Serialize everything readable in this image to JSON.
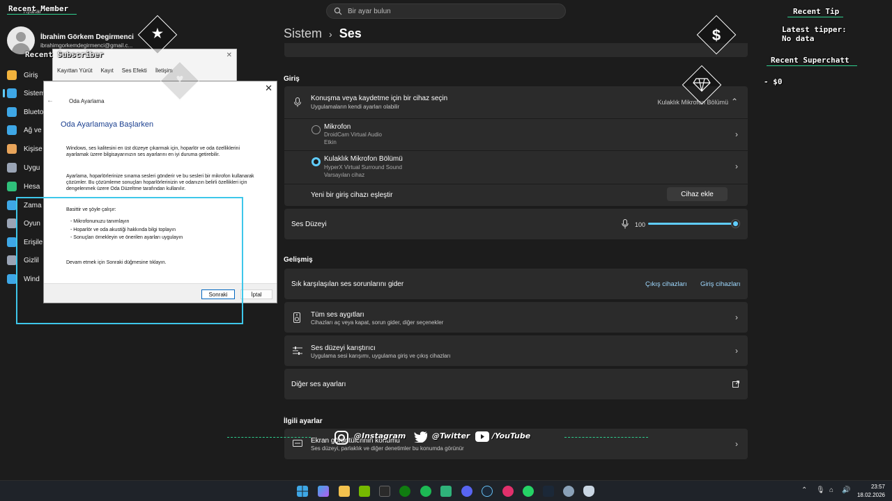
{
  "search": {
    "placeholder": "Bir ayar bulun"
  },
  "window": {
    "title": "Ayarlar"
  },
  "user": {
    "name": "İbrahim Görkem Degirmenci",
    "email": "ibrahimgorkemdegirmenci@gmail.c..."
  },
  "sidebar": {
    "items": [
      {
        "label": "Giriş",
        "color": "#f2b33d"
      },
      {
        "label": "Sistem",
        "color": "#3ea7e6"
      },
      {
        "label": "Bluetooth",
        "color": "#3ea7e6"
      },
      {
        "label": "Ağ ve",
        "color": "#3ea7e6"
      },
      {
        "label": "Kişise",
        "color": "#e8a45a"
      },
      {
        "label": "Uygu",
        "color": "#9aa4b5"
      },
      {
        "label": "Hesa",
        "color": "#2fbf7a"
      },
      {
        "label": "Zama",
        "color": "#3ea7e6"
      },
      {
        "label": "Oyun",
        "color": "#9aa4b5"
      },
      {
        "label": "Erişile",
        "color": "#3ea7e6"
      },
      {
        "label": "Gizlil",
        "color": "#9aa4b5"
      },
      {
        "label": "Wind",
        "color": "#3ea7e6"
      }
    ]
  },
  "breadcrumb": {
    "parent": "Sistem",
    "current": "Ses"
  },
  "input_section": {
    "label": "Giriş",
    "choose_title": "Konuşma veya kaydetme için bir cihaz seçin",
    "choose_sub": "Uygulamaların kendi ayarları olabilir",
    "choose_value": "Kulaklık Mikrofon Bölümü",
    "devices": [
      {
        "name": "Mikrofon",
        "line1": "DroidCam Virtual Audio",
        "line2": "Etkin",
        "selected": false
      },
      {
        "name": "Kulaklık Mikrofon Bölümü",
        "line1": "HyperX Virtual Surround Sound",
        "line2": "Varsayılan cihaz",
        "selected": true
      }
    ],
    "pair_label": "Yeni bir giriş cihazı eşleştir",
    "pair_button": "Cihaz ekle",
    "volume_label": "Ses Düzeyi",
    "volume_value": "100"
  },
  "advanced": {
    "label": "Gelişmiş",
    "troubleshoot_label": "Sık karşılaşılan ses sorunlarını gider",
    "link_output": "Çıkış cihazları",
    "link_input": "Giriş cihazları",
    "all_devices_title": "Tüm ses aygıtları",
    "all_devices_sub": "Cihazları aç veya kapat, sorun gider, diğer seçenekler",
    "mixer_title": "Ses düzeyi karıştırıcı",
    "mixer_sub": "Uygulama sesi karışımı, uygulama giriş ve çıkış cihazları",
    "more_label": "Diğer ses ayarları"
  },
  "related": {
    "label": "İlgili ayarlar",
    "item_title": "Ekran görüntülerinin konumu",
    "item_sub": "Ses düzeyi, parlaklık ve diğer denetimler bu konumda görünür"
  },
  "back_dialog": {
    "tabs": [
      "Kayıttan Yürüt",
      "Kayıt",
      "Ses Efekti",
      "İletişim"
    ]
  },
  "dialog": {
    "wizard_title": "Oda Ayarlama",
    "heading": "Oda Ayarlamaya Başlarken",
    "para1": "Windows, ses kalitesini en üst düzeye çıkarmak için, hoparlör ve oda özelliklerini ayarlamak üzere bilgisayarınızın ses ayarlarını en iyi duruma getirebilir.",
    "para2": "Ayarlama, hoparlörlerinize sınama sesleri gönderir ve bu sesleri bir mikrofon kullanarak çözümler. Bu çözümleme sonuçları hoparlörlerinizin ve odanızın belirli özellikleri için dengelenmek üzere Oda Düzeltme tarafından kullanılır.",
    "para3": "Basittir ve şöyle çalışır:",
    "steps": [
      "- Mikrofonunuzu tanımlayın",
      "- Hoparlör ve oda akustiği hakkında bilgi toplayın",
      "- Sonuçları örnekleyin ve önerilen ayarları uygulayın"
    ],
    "para4": "Devam etmek için Sonraki düğmesine tıklayın.",
    "next": "Sonraki",
    "cancel": "İptal"
  },
  "overlay": {
    "recent_member_title": "Recent Member",
    "recent_subscriber_title": "Recent Subscriber",
    "recent_tip_title": "Recent Tip",
    "latest_tipper": "Latest tipper: No data",
    "recent_superchat_title": "Recent Superchatt",
    "superchat_value": "- $0",
    "instagram": "@Instagram",
    "twitter": "@Twitter",
    "youtube": "/YouTube",
    "dollar_icon": "$"
  },
  "taskbar": {
    "time": "23:57",
    "date": "18.02.2026"
  }
}
